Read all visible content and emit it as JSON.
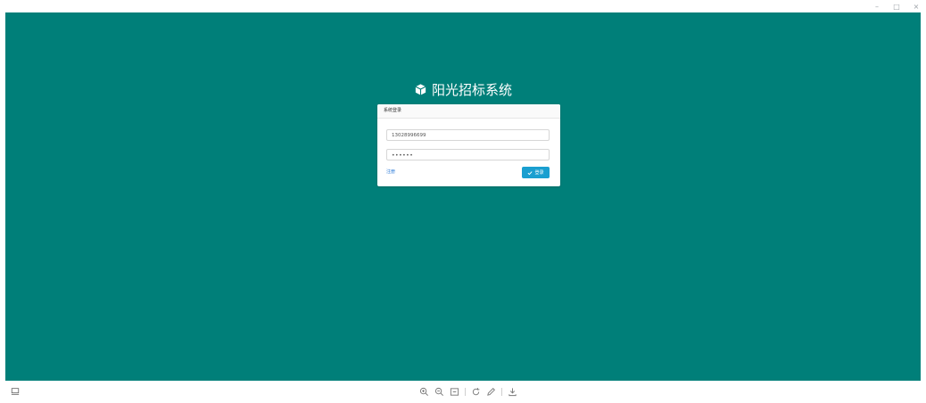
{
  "window": {
    "controls": {
      "minimize": "–",
      "maximize": "□",
      "close": "×"
    }
  },
  "app": {
    "title": "阳光招标系统",
    "logo_icon": "cube-icon"
  },
  "login": {
    "header": "系统登录",
    "username_value": "13028996699",
    "password_value": "••••••",
    "register_link": "注册",
    "login_button": "登录",
    "login_button_icon": "check-icon"
  },
  "colors": {
    "background": "#007f79",
    "panel": "#ffffff",
    "button": "#1a9fd0",
    "link": "#2a7ad8"
  },
  "bottom_toolbar": {
    "left_icon": "monitor-icon",
    "tools": [
      "zoom-in-icon",
      "zoom-out-icon",
      "fit-screen-icon",
      "rotate-icon",
      "edit-icon",
      "download-icon"
    ]
  }
}
